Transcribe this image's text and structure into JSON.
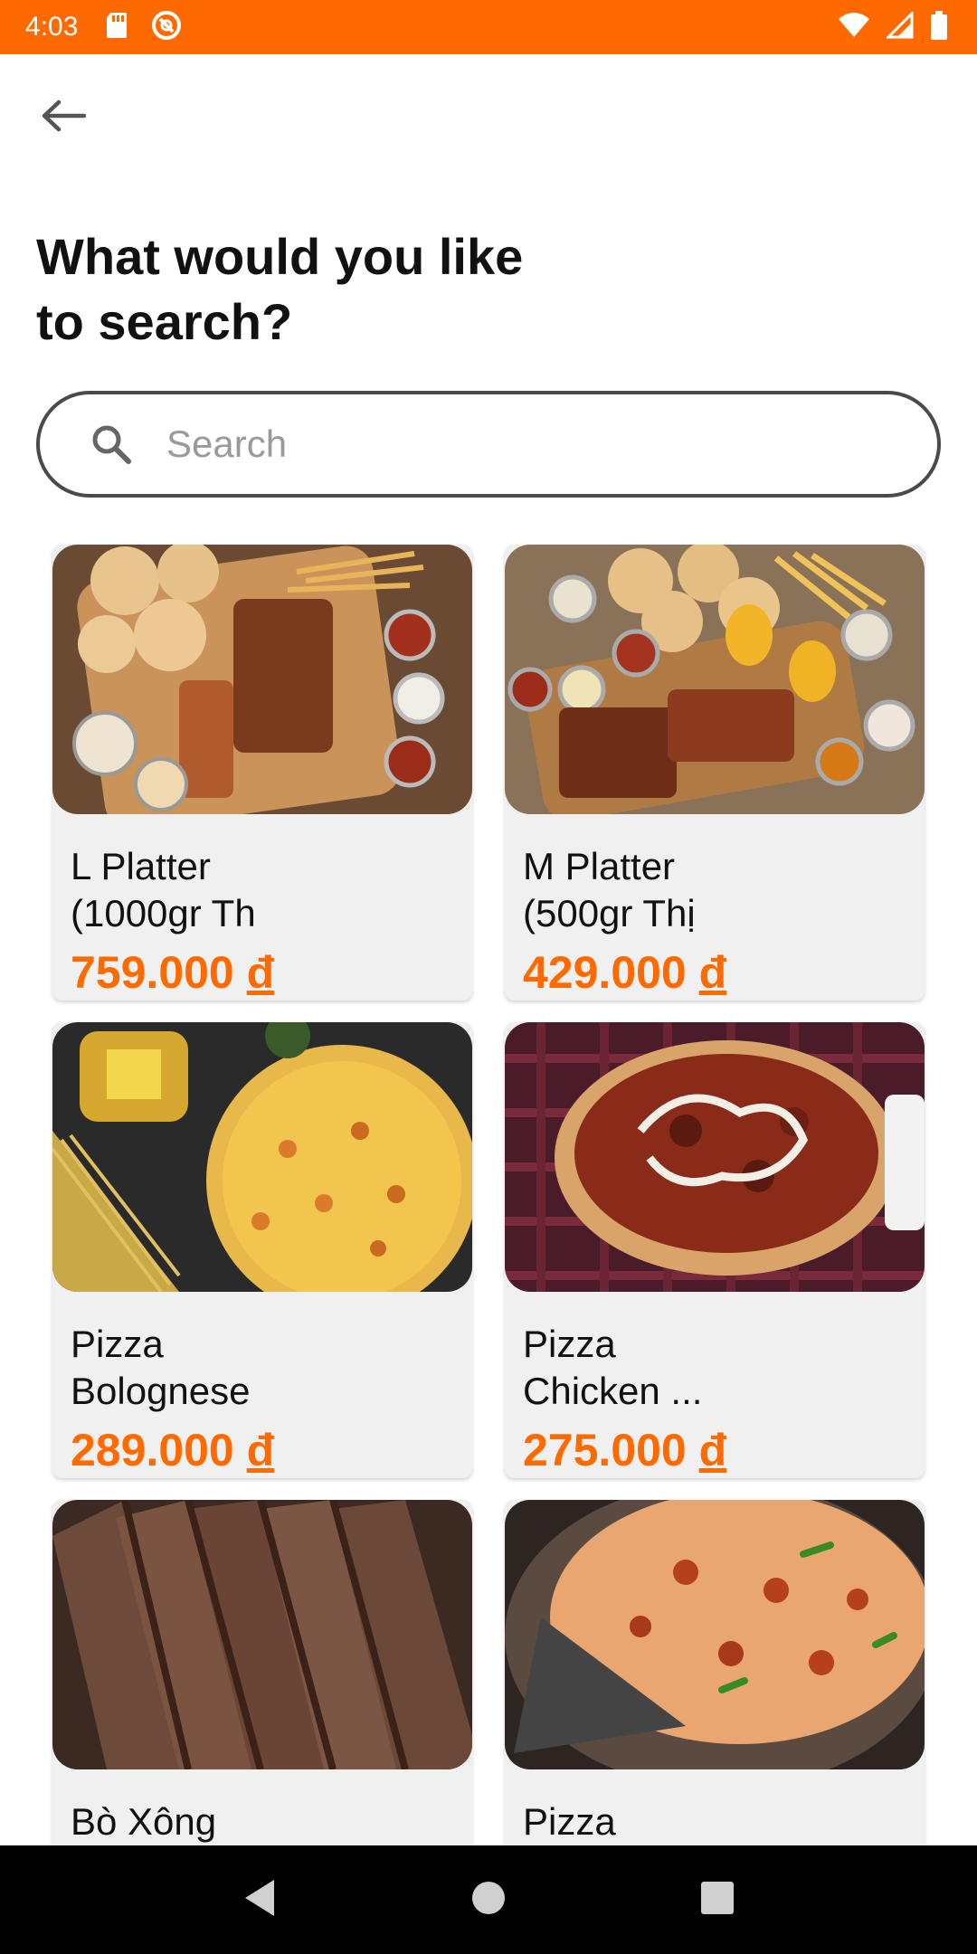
{
  "status_bar": {
    "time": "4:03",
    "left_icons": [
      "sd-card-icon",
      "alert-circle-icon"
    ],
    "right_icons": [
      "wifi-icon",
      "signal-icon",
      "battery-icon"
    ]
  },
  "header": {
    "back_icon": "arrow-left-icon",
    "title": "What would you like\n to search?"
  },
  "search": {
    "icon": "search-icon",
    "placeholder": "Search",
    "value": ""
  },
  "colors": {
    "accent": "#ff6a00",
    "card_background": "#f0f0f0",
    "nav_bar": "#000000"
  },
  "products": [
    {
      "name": "L Platter\n(1000gr Th",
      "price": "759.000",
      "currency": "đ",
      "image": "bbq-platter-photo"
    },
    {
      "name": "M Platter\n(500gr Thị",
      "price": "429.000",
      "currency": "đ",
      "image": "bbq-platter-photo"
    },
    {
      "name": "Pizza\nBolognese",
      "price": "289.000",
      "currency": "đ",
      "image": "pizza-photo"
    },
    {
      "name": "Pizza\nChicken ...",
      "price": "275.000",
      "currency": "đ",
      "image": "pizza-photo"
    },
    {
      "name": "Bò Xông",
      "price": "",
      "currency": "",
      "image": "smoked-beef-photo"
    },
    {
      "name": "Pizza",
      "price": "",
      "currency": "",
      "image": "pizza-photo"
    }
  ],
  "nav_bar": {
    "back_icon": "nav-back-icon",
    "home_icon": "nav-home-icon",
    "recents_icon": "nav-recents-icon"
  }
}
